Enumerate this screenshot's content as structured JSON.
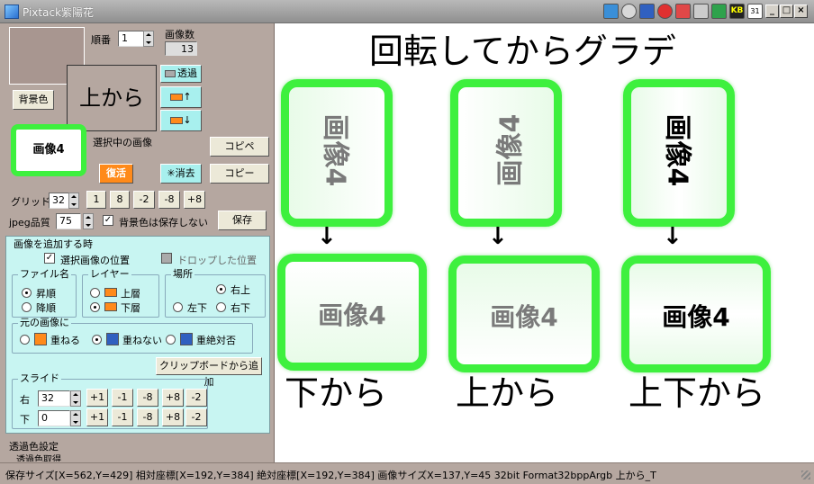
{
  "titlebar": {
    "title": "Pixtack紫陽花",
    "window_buttons": [
      "_",
      "□",
      "×"
    ],
    "tray_icons": [
      "app-icon-1",
      "app-icon-2",
      "app-icon-3",
      "app-icon-4",
      "app-icon-5",
      "app-icon-6",
      "app-icon-7",
      "kb-icon",
      "calendar-icon"
    ],
    "kb_label": "KB",
    "calendar_label": "31"
  },
  "left": {
    "order_label": "順番",
    "order_value": "1",
    "image_count_label": "画像数",
    "image_count_value": "13",
    "bg_color_button": "背景色",
    "preview_text": "上から",
    "selected_thumb_label": "画像4",
    "transparent_button": "透過",
    "layer_up_label": "↑",
    "layer_down_label": "↓",
    "selected_image_label": "選択中の画像",
    "restore_button": "復活",
    "delete_button": "消去",
    "copy_paste_button": "コピペ",
    "copy_button": "コピー",
    "grid_label": "グリッド",
    "grid_value": "32",
    "grid_buttons": [
      "1",
      "8",
      "-2",
      "-8",
      "+8"
    ],
    "jpeg_label": "jpeg品質",
    "jpeg_value": "75",
    "bg_no_save_label": "背景色は保存しない",
    "save_button": "保存",
    "add_section_title": "画像を追加する時",
    "selected_pos_label": "選択画像の位置",
    "dropped_pos_label": "ドロップした位置",
    "filename_group": "ファイル名",
    "asc_label": "昇順",
    "desc_label": "降順",
    "layer_group": "レイヤー",
    "upper_label": "上層",
    "lower_label": "下層",
    "place_group": "場所",
    "top_right_label": "右上",
    "bottom_left_label": "左下",
    "bottom_right_label": "右下",
    "original_group": "元の画像に",
    "overlap_label": "重ねる",
    "no_overlap_label": "重ねない",
    "strict_no_overlap_label": "重絶対否",
    "clipboard_button": "クリップボードから追加",
    "slide_group": "スライド",
    "right_label": "右",
    "right_value": "32",
    "down_label": "下",
    "down_value": "0",
    "slide_buttons": [
      "+1",
      "-1",
      "-8",
      "+8",
      "-2"
    ],
    "transparent_settings_title": "透過色設定",
    "transparent_sub_label": "透過色取得"
  },
  "canvas": {
    "heading": "回転してからグラデ",
    "card_text": "画像4",
    "arrow": "↓",
    "labels": [
      "下から",
      "上から",
      "上下から"
    ]
  },
  "status": {
    "text": "保存サイズ[X=562,Y=429]  相対座標[X=192,Y=384]  絶対座標[X=192,Y=384]  画像サイズX=137,Y=45  32bit  Format32bppArgb  上から_T"
  },
  "colors": {
    "panel": "#b5a7a0",
    "accent_cyan": "#c8f5f2",
    "card_border": "#3ef03e",
    "restore_orange": "#ff8a1a"
  }
}
